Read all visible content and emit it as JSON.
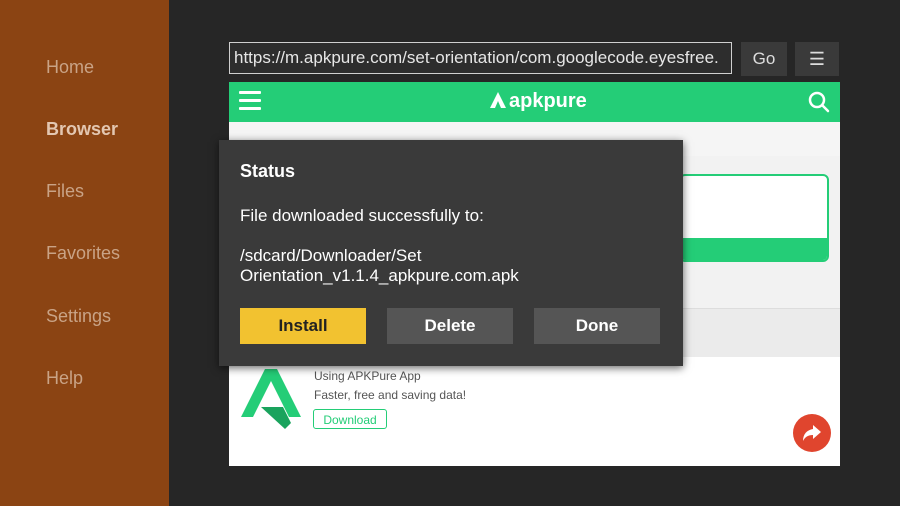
{
  "sidebar": {
    "items": [
      {
        "label": "Home"
      },
      {
        "label": "Browser",
        "active": true
      },
      {
        "label": "Files"
      },
      {
        "label": "Favorites"
      },
      {
        "label": "Settings"
      },
      {
        "label": "Help"
      }
    ]
  },
  "urlbar": {
    "url": "https://m.apkpure.com/set-orientation/com.googlecode.eyesfree.",
    "go_label": "Go",
    "menu_icon": "hamburger-icon"
  },
  "webpage": {
    "site_logo": "apkpure",
    "brand_color": "#24cd77",
    "promo": {
      "line1": "Using APKPure App",
      "line2": "Faster, free and saving data!",
      "download_label": "Download"
    }
  },
  "dialog": {
    "title": "Status",
    "message": "File downloaded successfully to:",
    "path_line1": "/sdcard/Downloader/Set",
    "path_line2": "Orientation_v1.1.4_apkpure.com.apk",
    "buttons": {
      "install": "Install",
      "delete": "Delete",
      "done": "Done"
    },
    "install_color": "#f2c230"
  },
  "colors": {
    "sidebar_bg": "#8b4413",
    "background": "#262626",
    "share_fab": "#e0452e"
  }
}
